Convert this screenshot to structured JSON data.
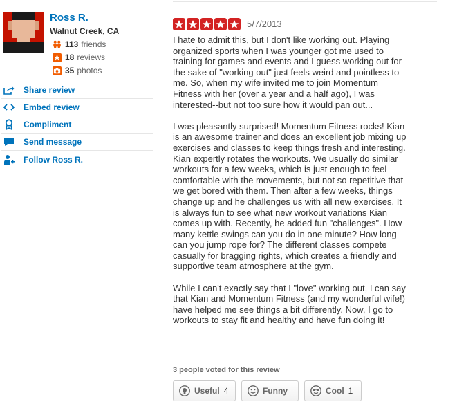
{
  "user": {
    "name": "Ross R.",
    "location": "Walnut Creek, CA",
    "friends_count": "113",
    "friends_label": "friends",
    "reviews_count": "18",
    "reviews_label": "reviews",
    "photos_count": "35",
    "photos_label": "photos"
  },
  "actions": [
    {
      "label": "Share review",
      "icon": "share-icon"
    },
    {
      "label": "Embed review",
      "icon": "embed-icon"
    },
    {
      "label": "Compliment",
      "icon": "compliment-icon"
    },
    {
      "label": "Send message",
      "icon": "message-icon"
    },
    {
      "label": "Follow Ross R.",
      "icon": "follow-icon"
    }
  ],
  "review": {
    "rating": 5,
    "rating_max": 5,
    "date": "5/7/2013",
    "paragraphs": [
      [
        "I hate to admit this, but I don't like working out. Playing",
        "organized sports when I was younger got me used to",
        "training for games and events and I guess working out for",
        "the sake of \"working out\" just feels weird and pointless to",
        "me. So, when my wife invited me to join Momentum",
        "Fitness with her (over a year and a half ago), I was",
        "interested--but not too sure how it would pan out..."
      ],
      [
        "I was pleasantly surprised! Momentum Fitness rocks! Kian",
        "is an awesome trainer and does an excellent job mixing up",
        "exercises and classes to keep things fresh and interesting.",
        "Kian expertly rotates the workouts. We usually do similar",
        "workouts for a few weeks, which is just enough to feel",
        "comfortable with the movements, but not so repetitive that",
        "we get bored with them. Then after a few weeks, things",
        "change up and he challenges us with all new exercises. It",
        "is always fun to see what new workout variations Kian",
        "comes up with. Recently, he added fun \"challenges\". How",
        "many kettle swings can you do in one minute? How long",
        "can you jump rope for? The different classes compete",
        "casually for bragging rights, which creates a friendly and",
        "supportive team atmosphere at the gym."
      ],
      [
        "While I can't exactly say that I \"love\" working out, I can say",
        "that Kian and Momentum Fitness  (and my wonderful wife!)",
        "have helped me see things a bit differently. Now, I go to",
        "workouts to stay fit and healthy and have fun doing it!"
      ]
    ]
  },
  "votes": {
    "note": "3 people voted for this review",
    "useful_label": "Useful",
    "useful_count": "4",
    "funny_label": "Funny",
    "cool_label": "Cool",
    "cool_count": "1"
  },
  "colors": {
    "link": "#0073bb",
    "star_red": "#d32323",
    "friends_orange": "#f15c00",
    "avatar_red": "#c41200"
  }
}
